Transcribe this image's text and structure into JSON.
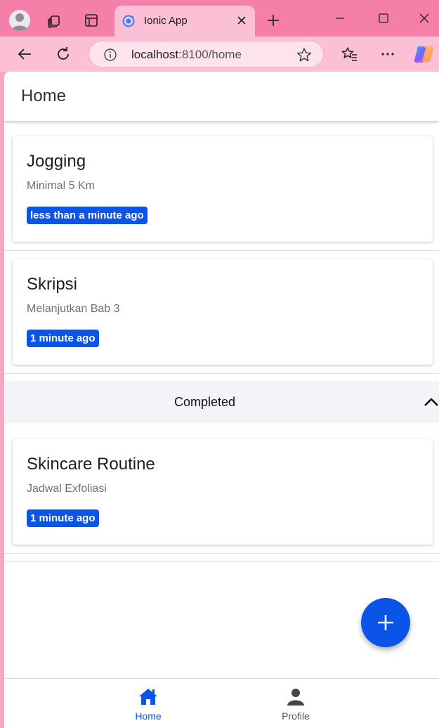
{
  "browser": {
    "tab_title": "Ionic App",
    "url_host": "localhost",
    "url_path": ":8100/home",
    "accent_color": "#f57fa9"
  },
  "app": {
    "page_title": "Home",
    "accent_color": "#0a54e8",
    "pending": [
      {
        "title": "Jogging",
        "subtitle": "Minimal 5 Km",
        "time": "less than a minute ago"
      },
      {
        "title": "Skripsi",
        "subtitle": "Melanjutkan Bab 3",
        "time": "1 minute ago"
      }
    ],
    "completed_section": {
      "label": "Completed",
      "icon": "chevron-up-icon",
      "items": [
        {
          "title": "Skincare Routine",
          "subtitle": "Jadwal Exfoliasi",
          "time": "1 minute ago"
        }
      ]
    },
    "fab_icon": "plus-icon",
    "tabs": [
      {
        "label": "Home",
        "icon": "home-icon",
        "active": true
      },
      {
        "label": "Profile",
        "icon": "person-icon",
        "active": false
      }
    ]
  }
}
